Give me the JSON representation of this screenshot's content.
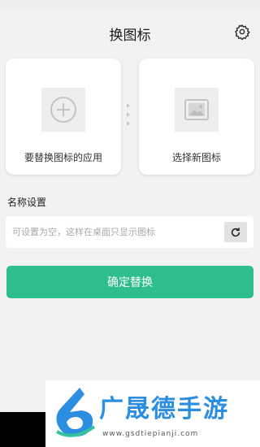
{
  "header": {
    "title": "换图标",
    "settings_icon": "gear-icon"
  },
  "cards": {
    "source": {
      "label": "要替换图标的应用",
      "icon": "plus-circle-icon"
    },
    "target": {
      "label": "选择新图标",
      "icon": "image-icon"
    }
  },
  "name_section": {
    "title": "名称设置",
    "input_value": "",
    "placeholder": "可设置为空，这样在桌面只显示图标",
    "reset_icon": "refresh-icon"
  },
  "confirm_button": {
    "label": "确定替换"
  },
  "colors": {
    "accent": "#2ebd8c",
    "background": "#f2f2f2",
    "banner_blue": "#2c8ee0"
  },
  "watermark": {
    "title": "广晟德手游",
    "url": "www.gsdtiepianji.com"
  }
}
